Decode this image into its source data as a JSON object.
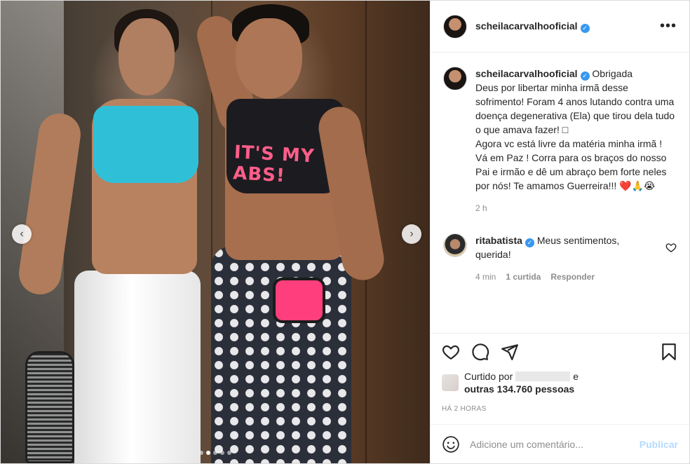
{
  "post": {
    "username": "scheilacarvalhooficial",
    "verified_mark": "✓",
    "more_label": "•••",
    "photo_caption_text": "IT'S MY ABS!",
    "carousel": {
      "prev_label": "‹",
      "next_label": "›",
      "dots_total": 5,
      "active_dot": 1
    }
  },
  "caption": {
    "username": "scheilacarvalhooficial",
    "text": "Obrigada\nDeus por libertar minha irmã desse sofrimento! Foram 4 anos lutando contra uma doença degenerativa (Ela) que tirou dela tudo o que amava fazer! □\nAgora vc está livre da matéria minha irmã ! Vá em Paz ! Corra para os braços do nosso Pai e irmão e dê um abraço bem forte neles por nós! Te amamos Guerreira!!! ❤️🙏😭",
    "age": "2 h"
  },
  "comment": {
    "username": "ritabatista",
    "text": "Meus sentimentos, querida!",
    "age": "4 min",
    "likes": "1 curtida",
    "reply": "Responder"
  },
  "likes": {
    "prefix": "Curtido por",
    "suffix": "e",
    "others": "outras 134.760 pessoas"
  },
  "timestamp": "HÁ 2 HORAS",
  "add_comment": {
    "placeholder": "Adicione um comentário...",
    "publish": "Publicar"
  },
  "icons": {
    "like": "heart-icon",
    "comment": "comment-icon",
    "share": "share-icon",
    "save": "bookmark-icon",
    "emoji": "emoji-icon",
    "options": "more-icon"
  },
  "colors": {
    "verified": "#3897f0",
    "publish_disabled": "#b3dbff",
    "muted_text": "#8e8e8e"
  }
}
